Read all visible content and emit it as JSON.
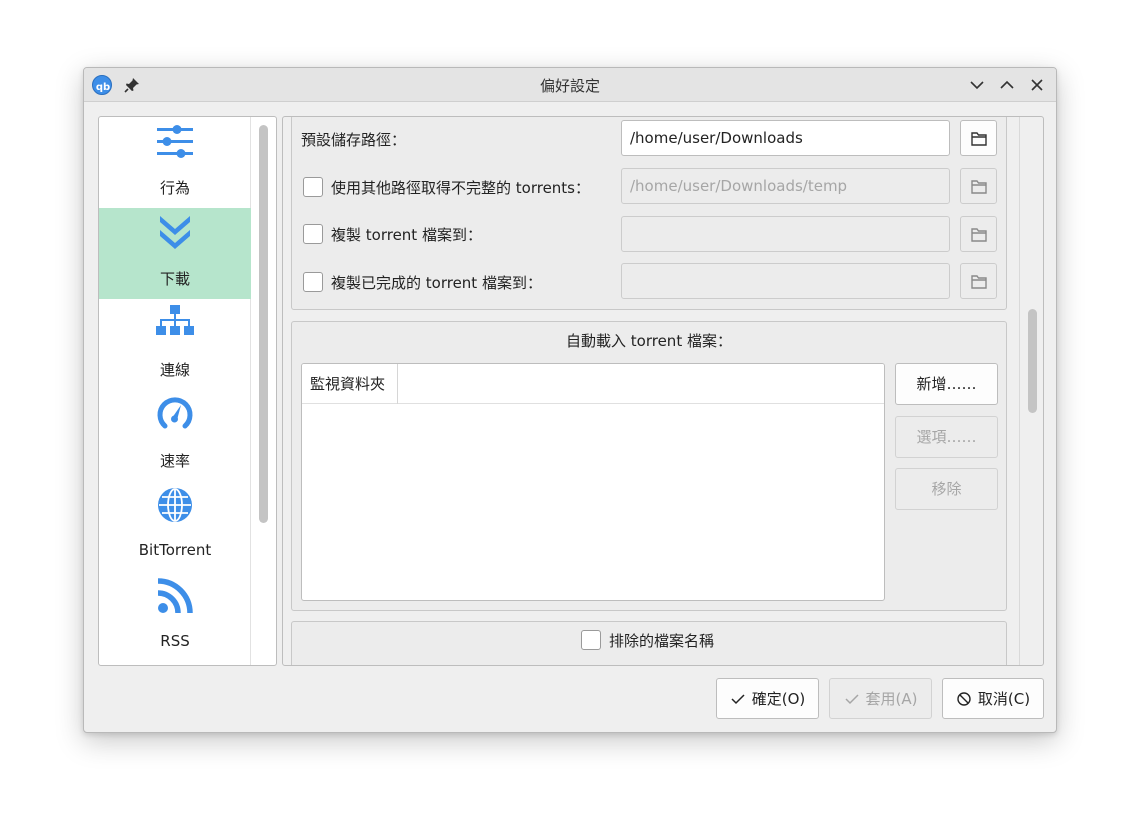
{
  "window": {
    "title": "偏好設定"
  },
  "sidebar": {
    "items": [
      {
        "label": "行為",
        "icon": "sliders-icon",
        "active": false
      },
      {
        "label": "下載",
        "icon": "double-chevron-down-icon",
        "active": true
      },
      {
        "label": "連線",
        "icon": "network-icon",
        "active": false
      },
      {
        "label": "速率",
        "icon": "speedometer-icon",
        "active": false
      },
      {
        "label": "BitTorrent",
        "icon": "globe-icon",
        "active": false
      },
      {
        "label": "RSS",
        "icon": "rss-icon",
        "active": false
      }
    ]
  },
  "saving": {
    "default_path_label": "預設儲存路徑：",
    "default_path_value": "/home/user/Downloads",
    "incomplete_label": "使用其他路徑取得不完整的 torrents：",
    "incomplete_value": "/home/user/Downloads/temp",
    "copy_torrent_label": "複製 torrent 檔案到：",
    "copy_finished_label": "複製已完成的 torrent 檔案到："
  },
  "autoload": {
    "title": "自動載入 torrent 檔案：",
    "column_header": "監視資料夾",
    "add_button": "新增……",
    "options_button": "選項……",
    "remove_button": "移除"
  },
  "exclude": {
    "label": "排除的檔案名稱"
  },
  "buttons": {
    "ok": "確定(O)",
    "apply": "套用(A)",
    "cancel": "取消(C)"
  },
  "colors": {
    "accent_blue": "#3d8ee8",
    "active_nav_bg": "#b6e5cc"
  }
}
